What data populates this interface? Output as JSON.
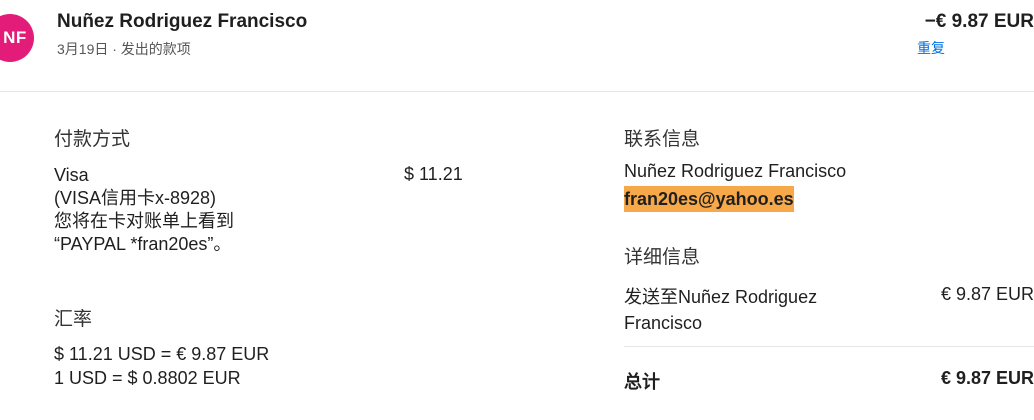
{
  "header": {
    "avatar_initials": "NF",
    "avatar_color": "#e31c79",
    "merchant_name": "Nuñez Rodriguez Francisco",
    "subline": "3月19日 · 发出的款项",
    "amount": "−€ 9.87 EUR",
    "repeat_label": "重复",
    "link_color": "#0070e0"
  },
  "payment_method": {
    "label": "付款方式",
    "description": "Visa\n(VISA信用卡x-8928)\n您将在卡对账单上看到\n“PAYPAL *fran20es”。",
    "amount": "$ 11.21"
  },
  "exchange_rate": {
    "label": "汇率",
    "line1": "$ 11.21 USD = € 9.87 EUR",
    "line2": "1 USD = $ 0.8802 EUR"
  },
  "contact": {
    "label": "联系信息",
    "name": "Nuñez Rodriguez Francisco",
    "email": "fran20es@yahoo.es",
    "email_highlight_color": "#f7a94a"
  },
  "details": {
    "label": "详细信息",
    "sent_to": "发送至Nuñez Rodriguez Francisco",
    "sent_amount": "€ 9.87 EUR",
    "total_label": "总计",
    "total_amount": "€ 9.87 EUR"
  }
}
